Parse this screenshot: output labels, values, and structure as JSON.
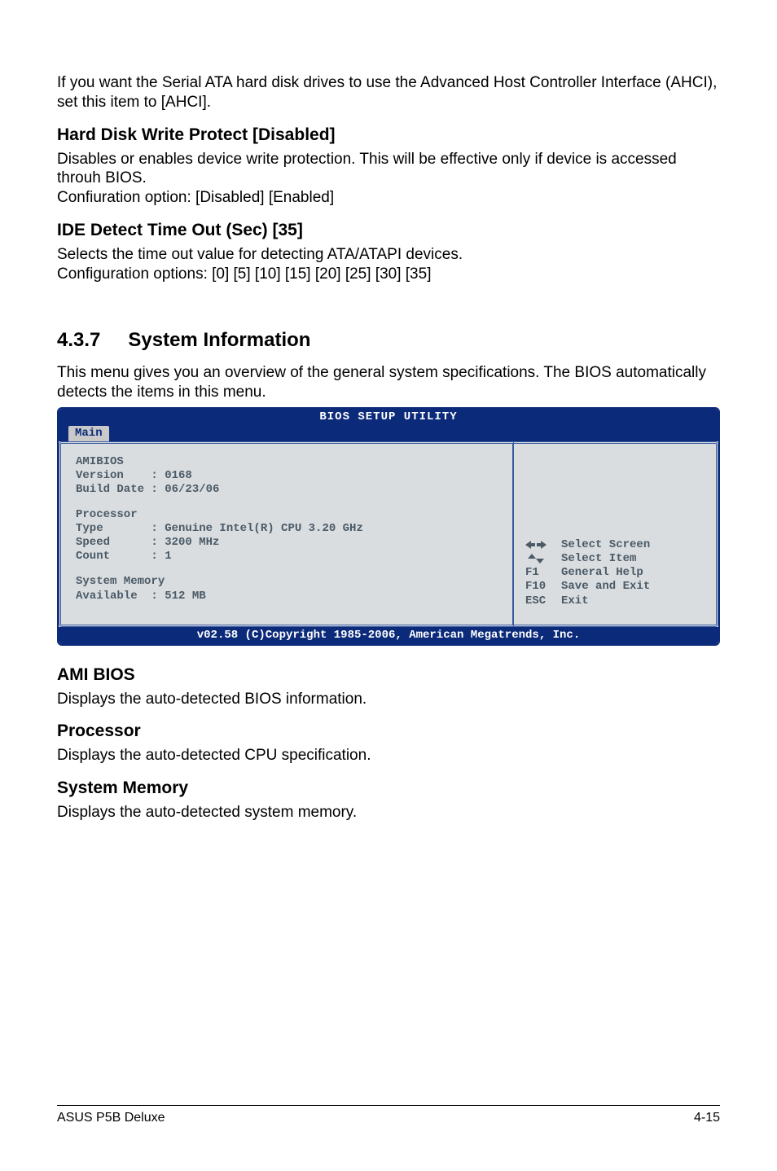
{
  "intro_para": "If you want the Serial ATA hard disk drives to use the Advanced Host Controller Interface (AHCI), set this item to [AHCI].",
  "sec1": {
    "title": "Hard Disk Write Protect [Disabled]",
    "p1": "Disables or enables device write protection. This will be effective only if device is accessed throuh BIOS.",
    "p2": "Confiuration option: [Disabled] [Enabled]"
  },
  "sec2": {
    "title": "IDE Detect Time Out (Sec) [35]",
    "p1": "Selects the time out value for detecting ATA/ATAPI devices.",
    "p2": "Configuration options: [0] [5] [10] [15] [20] [25] [30] [35]"
  },
  "section437": {
    "num": "4.3.7",
    "title": "System Information",
    "intro": "This menu gives you an overview of the general system specifications. The BIOS automatically detects the items in this menu."
  },
  "bios": {
    "title": "BIOS SETUP UTILITY",
    "tab": "Main",
    "amibios_label": "AMIBIOS",
    "version_line": "Version    : 0168",
    "build_line": "Build Date : 06/23/06",
    "proc_label": "Processor",
    "proc_type": "Type       : Genuine Intel(R) CPU 3.20 GHz",
    "proc_speed": "Speed      : 3200 MHz",
    "proc_count": "Count      : 1",
    "mem_label": "System Memory",
    "mem_avail": "Available  : 512 MB",
    "help": {
      "r1": "Select Screen",
      "r2": "Select Item",
      "r3k": "F1",
      "r3": "General Help",
      "r4k": "F10",
      "r4": "Save and Exit",
      "r5k": "ESC",
      "r5": "Exit"
    },
    "footer": "v02.58 (C)Copyright 1985-2006, American Megatrends, Inc."
  },
  "sec3": {
    "title": "AMI BIOS",
    "p": "Displays the auto-detected BIOS information."
  },
  "sec4": {
    "title": "Processor",
    "p": "Displays the auto-detected CPU specification."
  },
  "sec5": {
    "title": "System Memory",
    "p": "Displays the auto-detected system memory."
  },
  "footer": {
    "left": "ASUS P5B Deluxe",
    "right": "4-15"
  }
}
